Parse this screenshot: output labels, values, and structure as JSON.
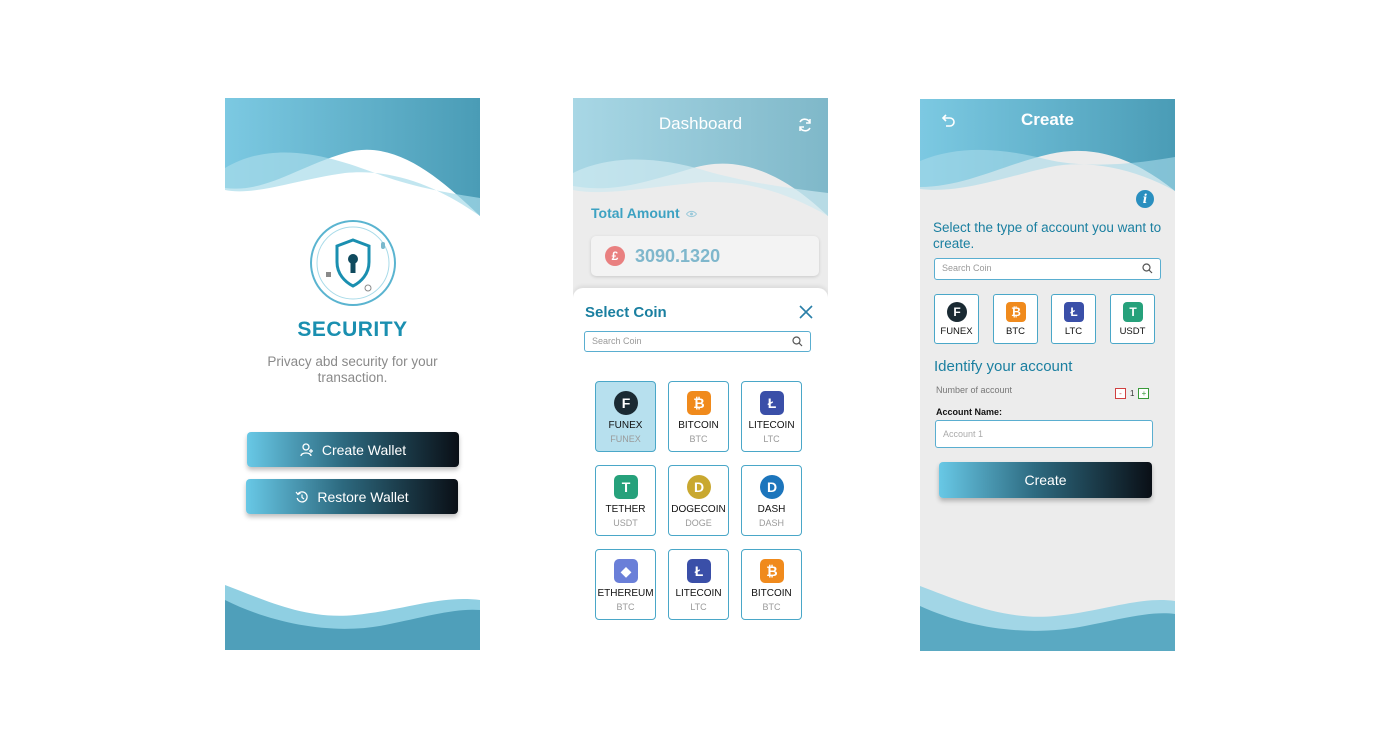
{
  "screen1": {
    "title": "SECURITY",
    "subtitle": "Privacy abd security for your transaction.",
    "create_wallet": "Create Wallet",
    "restore_wallet": "Restore Wallet"
  },
  "screen2": {
    "title": "Dashboard",
    "total_label": "Total Amount",
    "currency_symbol": "£",
    "amount": "3090.1320",
    "sheet_title": "Select Coin",
    "search_placeholder": "Search Coin",
    "coins": [
      {
        "name": "FUNEX",
        "ticker": "FUNEX",
        "icon": "funex-icon",
        "color": "#1a2a33",
        "selected": true
      },
      {
        "name": "BITCOIN",
        "ticker": "BTC",
        "icon": "bitcoin-icon",
        "color": "#f08a1c"
      },
      {
        "name": "LITECOIN",
        "ticker": "LTC",
        "icon": "litecoin-icon",
        "color": "#3a4fa8"
      },
      {
        "name": "TETHER",
        "ticker": "USDT",
        "icon": "tether-icon",
        "color": "#26a17b"
      },
      {
        "name": "DOGECOIN",
        "ticker": "DOGE",
        "icon": "dogecoin-icon",
        "color": "#c9a830"
      },
      {
        "name": "DASH",
        "ticker": "DASH",
        "icon": "dash-icon",
        "color": "#1c75bc"
      },
      {
        "name": "ETHEREUM",
        "ticker": "BTC",
        "icon": "ethereum-icon",
        "color": "#6a7fd8"
      },
      {
        "name": "LITECOIN",
        "ticker": "LTC",
        "icon": "litecoin-icon",
        "color": "#3a4fa8"
      },
      {
        "name": "BITCOIN",
        "ticker": "BTC",
        "icon": "bitcoin-icon",
        "color": "#f08a1c"
      }
    ]
  },
  "screen3": {
    "title": "Create",
    "select_label": "Select the type of account you want to create.",
    "search_placeholder": "Search Coin",
    "coins": [
      {
        "name": "FUNEX",
        "icon": "funex-icon",
        "color": "#1a2a33"
      },
      {
        "name": "BTC",
        "icon": "bitcoin-icon",
        "color": "#f08a1c"
      },
      {
        "name": "LTC",
        "icon": "litecoin-icon",
        "color": "#3a4fa8"
      },
      {
        "name": "USDT",
        "icon": "tether-icon",
        "color": "#26a17b"
      }
    ],
    "identify_heading": "Identify your account",
    "number_label": "Number of account",
    "number_value": "1",
    "minus": "-",
    "plus": "+",
    "account_name_label": "Account Name:",
    "account_name_placeholder": "Account 1",
    "create_button": "Create"
  },
  "glyphs": {
    "funex": "F",
    "bitcoin": "₿",
    "litecoin": "Ł",
    "tether": "T",
    "dogecoin": "D",
    "dash": "D",
    "ethereum": "◆",
    "info": "i"
  }
}
